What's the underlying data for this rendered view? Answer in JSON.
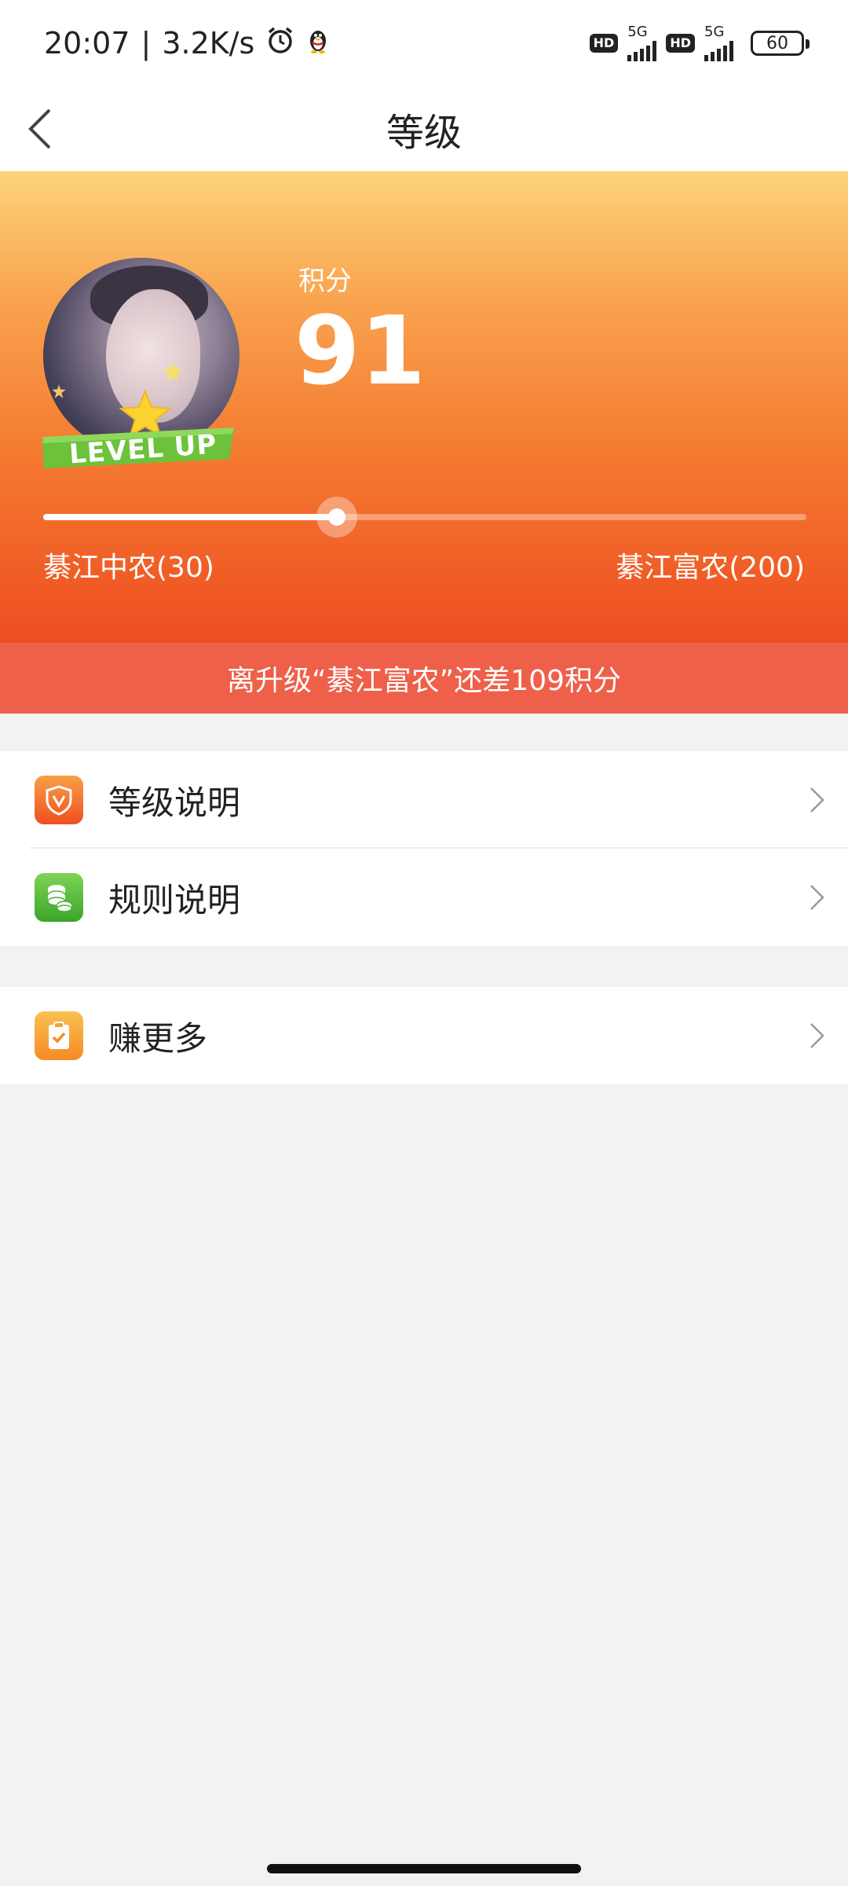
{
  "status_bar": {
    "time": "20:07",
    "speed": "3.2K/s",
    "network_labels": [
      "5G",
      "5G"
    ],
    "hd_badges": [
      "HD",
      "HD"
    ],
    "battery": "60"
  },
  "nav": {
    "title": "等级"
  },
  "profile": {
    "badge_text": "LEVEL UP",
    "score_label": "积分",
    "score": "91"
  },
  "progress": {
    "current_level": "綦江中农(30)",
    "next_level": "綦江富农(200)",
    "fill_fraction": 0.385
  },
  "upgrade_banner": {
    "text": "离升级“綦江富农”还差109积分"
  },
  "menu_group_1": [
    {
      "label": "等级说明",
      "icon": "shield-v-icon",
      "color": "#f25a28"
    },
    {
      "label": "规则说明",
      "icon": "coins-stack-icon",
      "color": "#5bbd3a"
    }
  ],
  "menu_group_2": [
    {
      "label": "赚更多",
      "icon": "clipboard-check-icon",
      "color": "#f7952b"
    }
  ],
  "colors": {
    "accent_orange": "#f47a30",
    "banner": "#ee604a"
  }
}
